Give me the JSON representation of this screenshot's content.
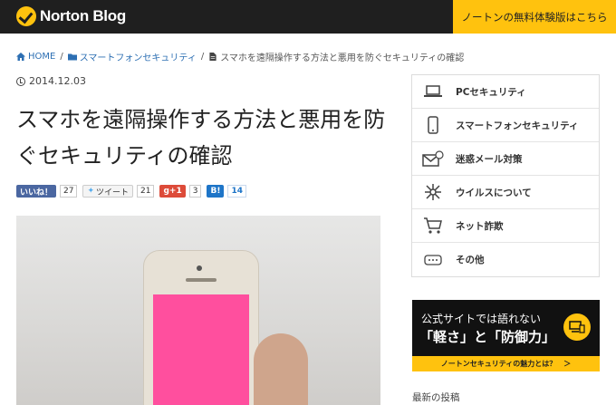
{
  "header": {
    "logo_text": "Norton Blog",
    "cta": "ノートンの無料体験版はこちら"
  },
  "breadcrumb": {
    "home": "HOME",
    "category": "スマートフォンセキュリティ",
    "current": "スマホを遠隔操作する方法と悪用を防ぐセキュリティの確認",
    "separator": "/"
  },
  "article": {
    "date": "2014.12.03",
    "title": "スマホを遠隔操作する方法と悪用を防ぐセキュリティの確認"
  },
  "social": {
    "facebook_label": "いいね！",
    "facebook_count": "27",
    "twitter_label": "ツイート",
    "twitter_count": "21",
    "gplus_label": "g+1",
    "gplus_count": "3",
    "hatena_label": "B!",
    "hatena_count": "14"
  },
  "sidebar": {
    "items": [
      {
        "label": "PCセキュリティ",
        "icon": "laptop-icon"
      },
      {
        "label": "スマートフォンセキュリティ",
        "icon": "smartphone-icon"
      },
      {
        "label": "迷惑メール対策",
        "icon": "mail-icon"
      },
      {
        "label": "ウイルスについて",
        "icon": "virus-icon"
      },
      {
        "label": "ネット詐欺",
        "icon": "cart-icon"
      },
      {
        "label": "その他",
        "icon": "more-icon"
      }
    ]
  },
  "banner": {
    "line1": "公式サイトでは語れない",
    "line2": "「軽さ」と「防御力」",
    "footer": "ノートンセキュリティの魅力とは？　＞"
  },
  "recent_posts_heading": "最新の投稿",
  "colors": {
    "accent": "#ffc20e",
    "header_bg": "#1f1f1f",
    "link": "#2d6fb3",
    "phone_screen": "#ff4f9e"
  }
}
